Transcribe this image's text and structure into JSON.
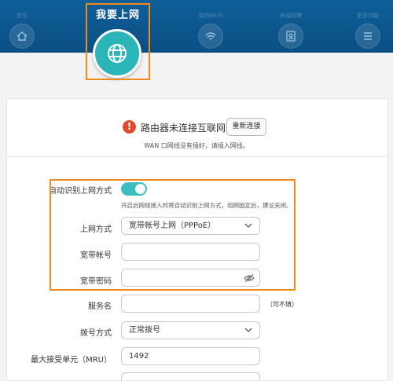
{
  "nav": {
    "items": [
      {
        "label": "首页",
        "icon": "home-icon"
      },
      {
        "label": "我要上网",
        "icon": "globe-icon"
      },
      {
        "label": "我的Wi-Fi",
        "icon": "wifi-icon"
      },
      {
        "label": "终端管理",
        "icon": "device-icon"
      },
      {
        "label": "更多功能",
        "icon": "menu-icon"
      }
    ],
    "active_index": 1
  },
  "status": {
    "message": "路由器未连接互联网",
    "reconnect_label": "重新连接",
    "hint": "WAN 口网线没有插好，请插入网线。"
  },
  "form": {
    "auto_detect": {
      "label": "自动识别上网方式",
      "enabled": true,
      "hint": "开启后网线接入时将自动识别上网方式，组网固定后，建议关闭。"
    },
    "mode": {
      "label": "上网方式",
      "value": "宽带帐号上网（PPPoE）"
    },
    "account": {
      "label": "宽带帐号",
      "value": ""
    },
    "password": {
      "label": "宽带密码",
      "value": ""
    },
    "service": {
      "label": "服务名",
      "value": "",
      "note": "（可不填）"
    },
    "dial": {
      "label": "拨号方式",
      "value": "正常拨号"
    },
    "mru": {
      "label": "最大接受单元（MRU）",
      "value": "1492"
    }
  },
  "colors": {
    "header": "#0a4f84",
    "accent": "#2bb5b8",
    "highlight": "#f08a1c",
    "error": "#e14b2d"
  }
}
